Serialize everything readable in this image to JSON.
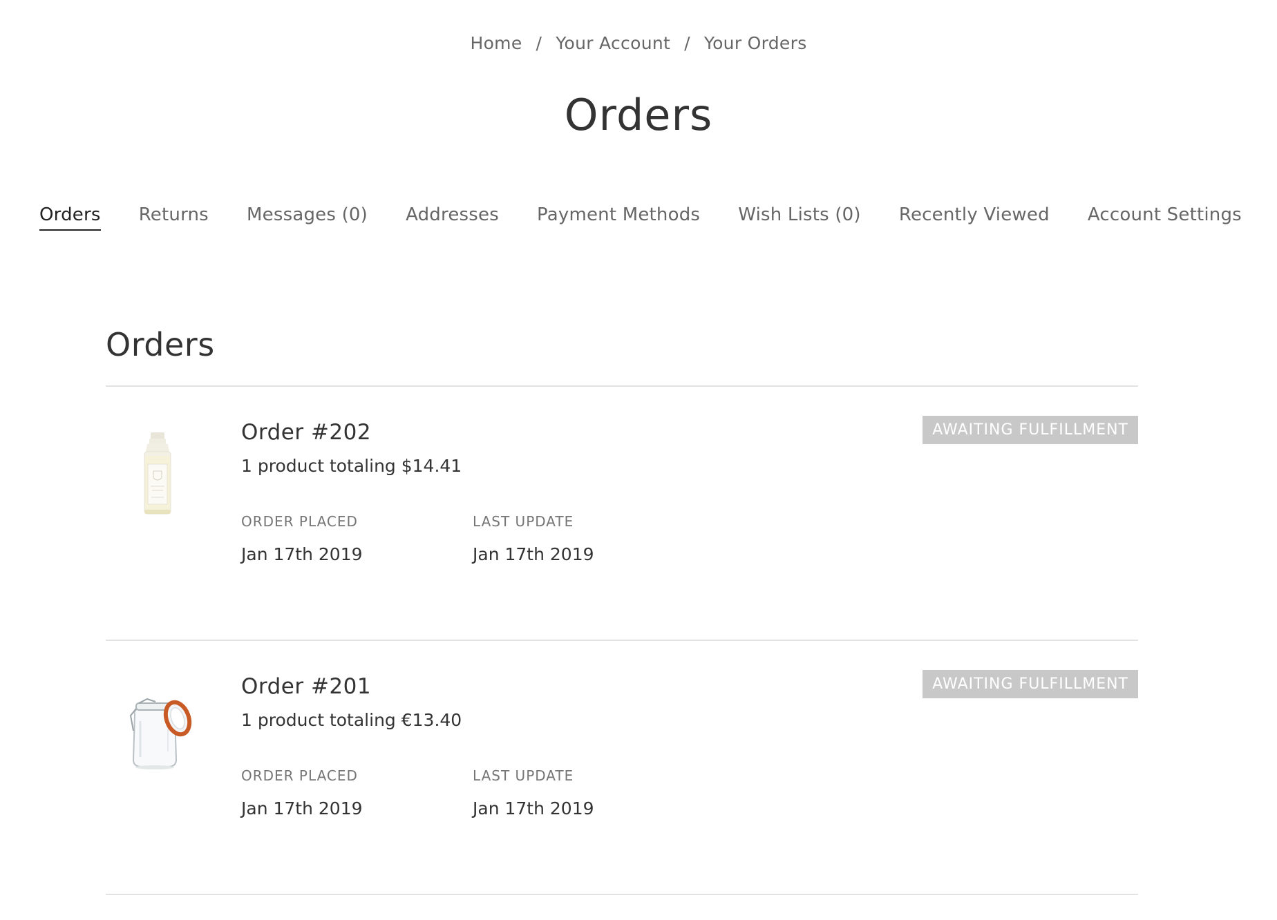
{
  "breadcrumb": {
    "home": "Home",
    "sep1": "/",
    "account": "Your Account",
    "sep2": "/",
    "orders": "Your Orders"
  },
  "page_title": "Orders",
  "nav": {
    "items": [
      {
        "label": "Orders",
        "active": true
      },
      {
        "label": "Returns"
      },
      {
        "label": "Messages (0)"
      },
      {
        "label": "Addresses"
      },
      {
        "label": "Payment Methods"
      },
      {
        "label": "Wish Lists (0)"
      },
      {
        "label": "Recently Viewed"
      },
      {
        "label": "Account Settings"
      }
    ]
  },
  "section_title": "Orders",
  "orders": [
    {
      "title": "Order #202",
      "summary": "1 product totaling $14.41",
      "status": "AWAITING FULFILLMENT",
      "placed_label": "ORDER PLACED",
      "placed_value": "Jan 17th 2019",
      "updated_label": "LAST UPDATE",
      "updated_value": "Jan 17th 2019",
      "thumbnail_icon": "soap-bottle-icon"
    },
    {
      "title": "Order #201",
      "summary": "1 product totaling €13.40",
      "status": "AWAITING FULFILLMENT",
      "placed_label": "ORDER PLACED",
      "placed_value": "Jan 17th 2019",
      "updated_label": "LAST UPDATE",
      "updated_value": "Jan 17th 2019",
      "thumbnail_icon": "glass-jar-icon"
    }
  ],
  "colors": {
    "badge_bg": "#c8c8c8",
    "divider": "#e2e2e2",
    "text_dark": "#333333",
    "text_muted": "#666666"
  }
}
